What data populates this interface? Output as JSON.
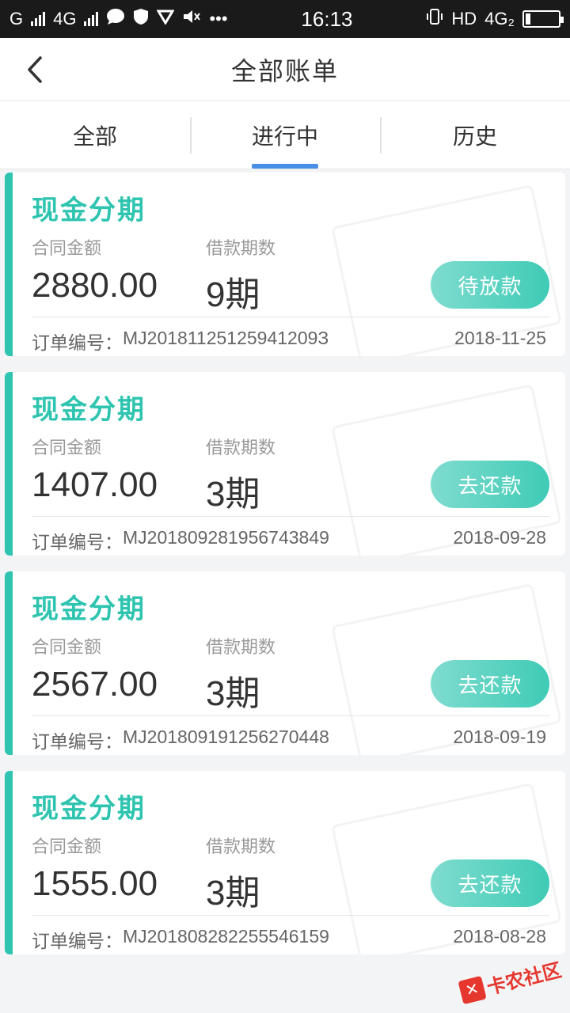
{
  "status_bar": {
    "carrier1": "G",
    "carrier2": "4G",
    "time": "16:13",
    "hd": "HD",
    "net": "4G₂"
  },
  "header": {
    "title": "全部账单"
  },
  "tabs": [
    {
      "label": "全部",
      "active": false
    },
    {
      "label": "进行中",
      "active": true
    },
    {
      "label": "历史",
      "active": false
    }
  ],
  "cards": [
    {
      "type": "现金分期",
      "amount_label": "合同金额",
      "period_label": "借款期数",
      "amount": "2880.00",
      "periods": "9期",
      "action": "待放款",
      "order_prefix": "订单编号：",
      "order_no": "MJ20181125125941209З",
      "date": "2018-11-25"
    },
    {
      "type": "现金分期",
      "amount_label": "合同金额",
      "period_label": "借款期数",
      "amount": "1407.00",
      "periods": "3期",
      "action": "去还款",
      "order_prefix": "订单编号：",
      "order_no": "MJ201809281956743849",
      "date": "2018-09-28"
    },
    {
      "type": "现金分期",
      "amount_label": "合同金额",
      "period_label": "借款期数",
      "amount": "2567.00",
      "periods": "3期",
      "action": "去还款",
      "order_prefix": "订单编号：",
      "order_no": "MJ201809191256270448",
      "date": "2018-09-19"
    },
    {
      "type": "现金分期",
      "amount_label": "合同金额",
      "period_label": "借款期数",
      "amount": "1555.00",
      "periods": "3期",
      "action": "去还款",
      "order_prefix": "订单编号：",
      "order_no": "MJ201808282255546159",
      "date": "2018-08-28"
    }
  ],
  "watermark": {
    "text": "卡农社区"
  },
  "colors": {
    "accent": "#2ec4b0",
    "tab_indicator": "#4a8fe7"
  }
}
